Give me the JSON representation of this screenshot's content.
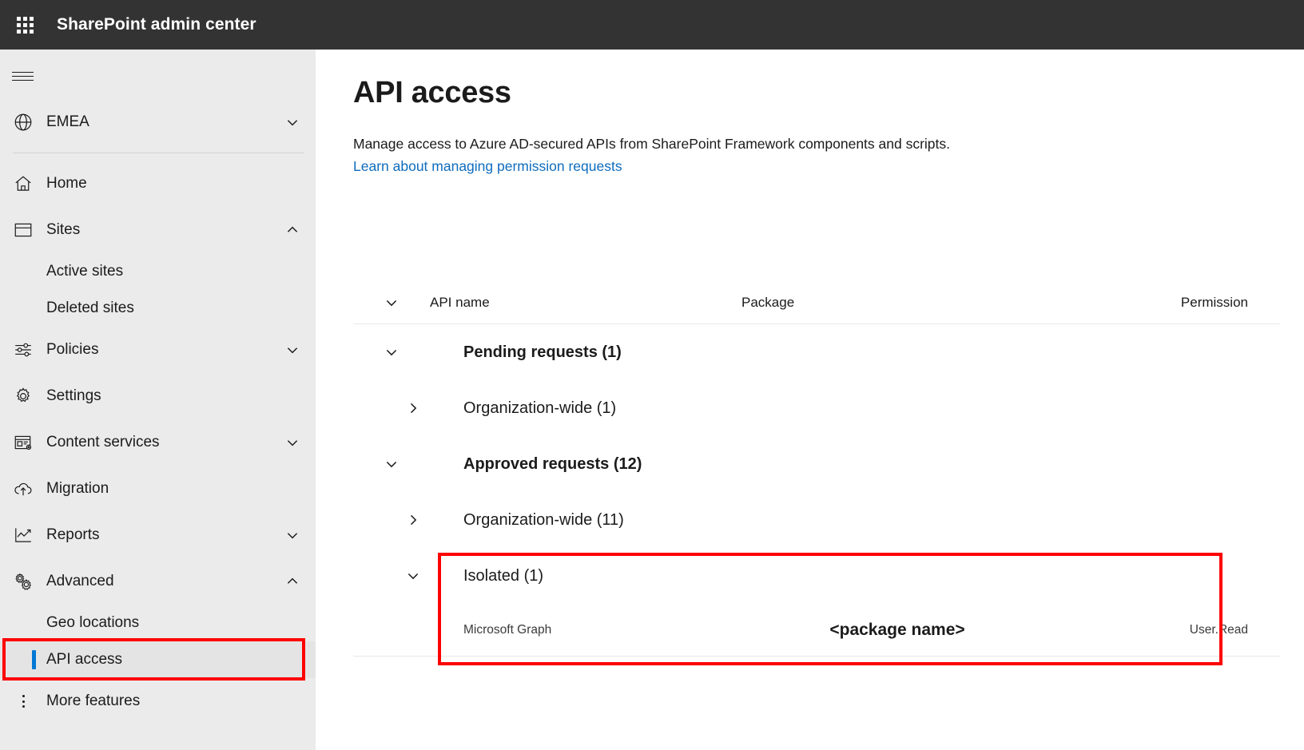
{
  "suite": {
    "waffle_icon": "app-launcher-icon",
    "title": "SharePoint admin center"
  },
  "sidebar": {
    "hamburger_icon": "hamburger-menu-icon",
    "geo": {
      "icon": "globe-icon",
      "label": "EMEA",
      "chevron": "chevron-down-icon"
    },
    "items": [
      {
        "label": "Home",
        "icon": "home-icon",
        "chevron": ""
      },
      {
        "label": "Sites",
        "icon": "sites-icon",
        "chevron": "chevron-up-icon"
      },
      {
        "label": "Active sites",
        "icon": "",
        "chevron": ""
      },
      {
        "label": "Deleted sites",
        "icon": "",
        "chevron": ""
      },
      {
        "label": "Policies",
        "icon": "policies-icon",
        "chevron": "chevron-down-icon"
      },
      {
        "label": "Settings",
        "icon": "gear-icon",
        "chevron": ""
      },
      {
        "label": "Content services",
        "icon": "content-services-icon",
        "chevron": "chevron-down-icon"
      },
      {
        "label": "Migration",
        "icon": "cloud-upload-icon",
        "chevron": ""
      },
      {
        "label": "Reports",
        "icon": "chart-line-icon",
        "chevron": "chevron-down-icon"
      },
      {
        "label": "Advanced",
        "icon": "advanced-gears-icon",
        "chevron": "chevron-up-icon"
      },
      {
        "label": "Geo locations",
        "icon": "",
        "chevron": ""
      },
      {
        "label": "API access",
        "icon": "",
        "chevron": ""
      },
      {
        "label": "More features",
        "icon": "more-vertical-icon",
        "chevron": ""
      }
    ],
    "selected_item": "API access"
  },
  "main": {
    "title": "API access",
    "description": "Manage access to Azure AD-secured APIs from SharePoint Framework components and scripts.",
    "link": "Learn about managing permission requests"
  },
  "table": {
    "toggle_icon": "chevron-down-icon",
    "columns": {
      "api_name": "API name",
      "package": "Package",
      "permission": "Permission"
    },
    "groups": [
      {
        "label": "Pending requests (1)",
        "chevron": "chevron-down-icon",
        "children": [
          {
            "label": "Organization-wide (1)",
            "chevron": "chevron-right-icon"
          }
        ]
      },
      {
        "label": "Approved requests (12)",
        "chevron": "chevron-down-icon",
        "children": [
          {
            "label": "Organization-wide (11)",
            "chevron": "chevron-right-icon"
          },
          {
            "label": "Isolated (1)",
            "chevron": "chevron-down-icon"
          }
        ]
      }
    ],
    "rows": [
      {
        "api_name": "Microsoft Graph",
        "package": "<package name>",
        "permission": "User.Read"
      }
    ]
  },
  "annotations": {
    "highlight_color": "#ff0000",
    "boxes": [
      "sidebar-api-access",
      "isolated-group"
    ]
  },
  "colors": {
    "suite_bar": "#333333",
    "nav_background": "#ebebeb",
    "accent": "#0078d4",
    "link": "#0f6cbd",
    "annotation": "#ff0000"
  }
}
